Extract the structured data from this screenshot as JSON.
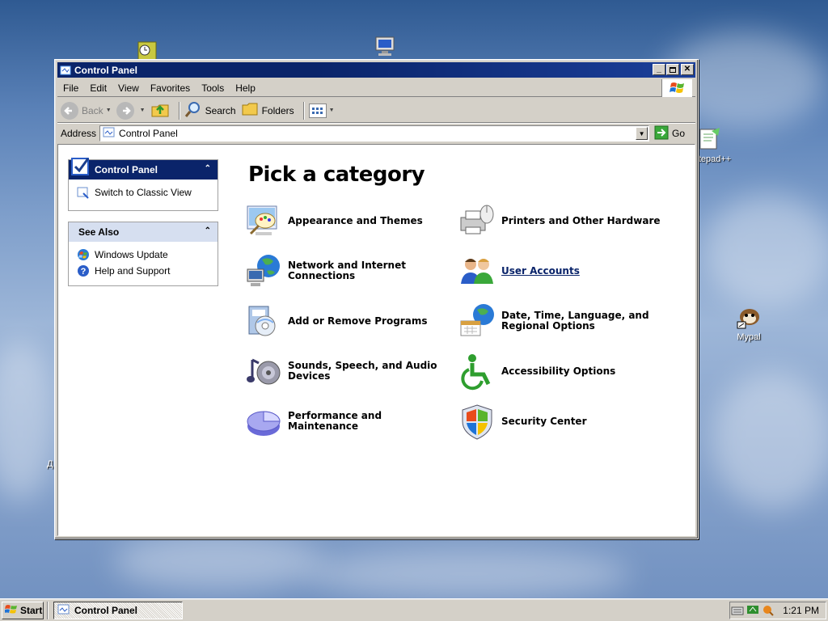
{
  "desktop": {
    "icons": [
      {
        "label": ""
      },
      {
        "label": ""
      },
      {
        "label": "tepad++"
      },
      {
        "label": "Mypal"
      }
    ],
    "left_edge_text": "Д"
  },
  "window": {
    "title": "Control Panel",
    "menu": [
      "File",
      "Edit",
      "View",
      "Favorites",
      "Tools",
      "Help"
    ],
    "toolbar": {
      "back": "Back",
      "search": "Search",
      "folders": "Folders"
    },
    "address": {
      "label": "Address",
      "value": "Control Panel",
      "go": "Go"
    }
  },
  "left_panels": {
    "control_panel": {
      "title": "Control Panel",
      "items": [
        {
          "label": "Switch to Classic View",
          "icon": "switch-view-icon"
        }
      ]
    },
    "see_also": {
      "title": "See Also",
      "items": [
        {
          "label": "Windows Update",
          "icon": "windows-update-icon"
        },
        {
          "label": "Help and Support",
          "icon": "help-icon"
        }
      ]
    }
  },
  "main": {
    "heading": "Pick a category",
    "categories": [
      {
        "label": "Appearance and Themes",
        "icon": "appearance-icon"
      },
      {
        "label": "Printers and Other Hardware",
        "icon": "printer-icon"
      },
      {
        "label": "Network and Internet Connections",
        "icon": "network-icon"
      },
      {
        "label": "User Accounts",
        "icon": "user-accounts-icon"
      },
      {
        "label": "Add or Remove Programs",
        "icon": "add-remove-icon"
      },
      {
        "label": "Date, Time, Language, and Regional Options",
        "icon": "datetime-icon"
      },
      {
        "label": "Sounds, Speech, and Audio Devices",
        "icon": "sound-icon"
      },
      {
        "label": "Accessibility Options",
        "icon": "accessibility-icon"
      },
      {
        "label": "Performance and Maintenance",
        "icon": "performance-icon"
      },
      {
        "label": "Security Center",
        "icon": "security-icon"
      }
    ]
  },
  "taskbar": {
    "start": "Start",
    "task": "Control Panel",
    "clock": "1:21 PM"
  },
  "colors": {
    "title_bar": "#0a246a",
    "panel_header_blue": "#0a246a",
    "link_blue": "#0a246a"
  }
}
